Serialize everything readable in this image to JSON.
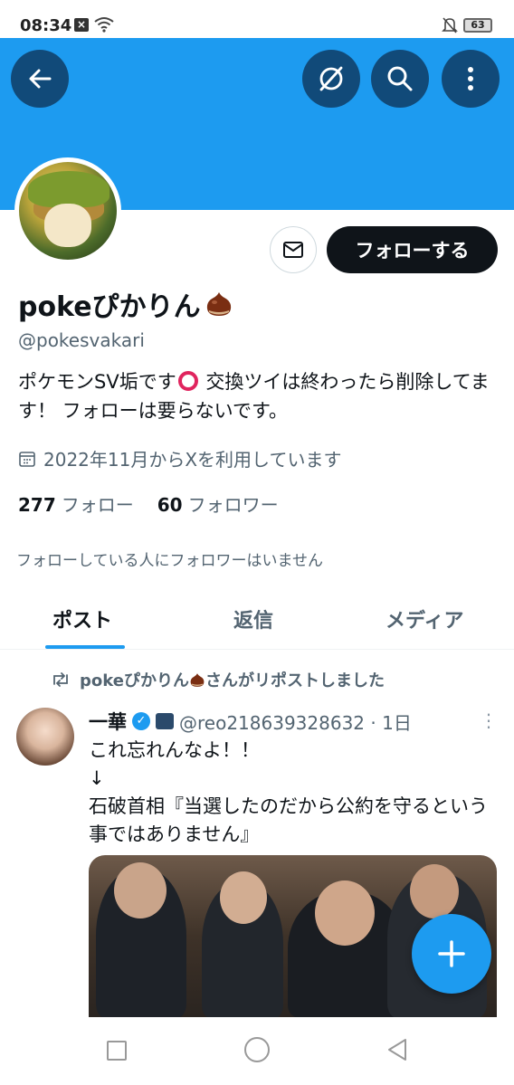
{
  "status_bar": {
    "time": "08:34",
    "battery": "63"
  },
  "header": {
    "banner_color": "#1d9bf0"
  },
  "profile": {
    "name": "pokeぴかりん",
    "handle": "@pokesvakari",
    "bio_part1": "ポケモンSV垢です",
    "bio_part2": " 交換ツイは終わったら削除してます！ フォローは要らないです。",
    "joined": "2022年11月からXを利用しています",
    "following_count": "277",
    "following_label": "フォロー",
    "followers_count": "60",
    "followers_label": "フォロワー",
    "followed_by_note": "フォローしている人にフォロワーはいません",
    "follow_button": "フォローする"
  },
  "tabs": [
    {
      "label": "ポスト",
      "active": true
    },
    {
      "label": "返信",
      "active": false
    },
    {
      "label": "メディア",
      "active": false
    }
  ],
  "feed": {
    "repost_note": "pokeぴかりん",
    "repost_suffix": "さんがリポストしました",
    "post": {
      "author": "一華",
      "meta": "@reo218639328632 · 1日",
      "text_line1": "これ忘れんなよ！！",
      "text_line2": "↓",
      "text_line3": "石破首相『当選したのだから公約を守るという事ではありません』"
    }
  },
  "colors": {
    "accent": "#1d9bf0",
    "text": "#0f1419",
    "muted": "#536471"
  }
}
